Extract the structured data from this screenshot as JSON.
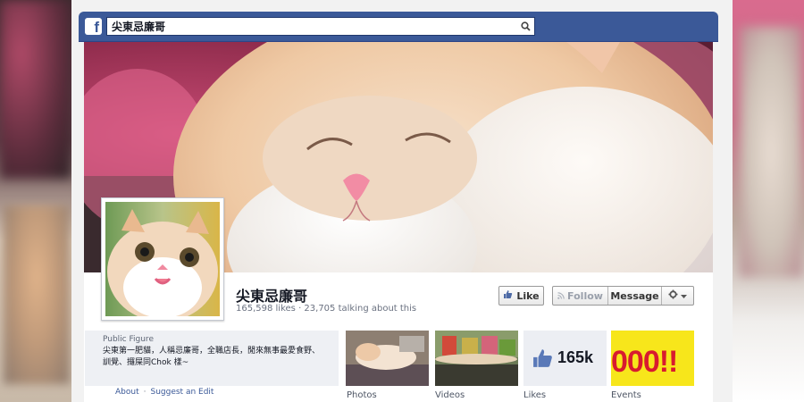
{
  "topbar": {
    "search_value": "尖東忌廉哥",
    "icons": {
      "logo": "facebook-logo",
      "search": "magnifier-icon"
    }
  },
  "page": {
    "name": "尖東忌廉哥",
    "stats": "165,598 likes · 23,705 talking about this"
  },
  "actions": {
    "like_label": "Like",
    "follow_label": "Follow",
    "message_label": "Message",
    "icons": {
      "like": "thumbs-up-icon",
      "follow": "rss-icon",
      "settings": "gear-icon",
      "dropdown": "caret-down-icon"
    }
  },
  "about": {
    "category": "Public Figure",
    "description": "尖東第一肥貓，人稱忌廉哥，全職店長，閒來無事最愛食野、訓覺、攞屎同Chok 樣~",
    "link_about": "About",
    "separator": "·",
    "link_suggest": "Suggest an Edit"
  },
  "apps": [
    {
      "label": "Photos"
    },
    {
      "label": "Videos"
    },
    {
      "label": "Likes",
      "count": "165k"
    },
    {
      "label": "Events",
      "image_text": "000!!"
    }
  ],
  "colors": {
    "facebook_blue": "#3b5998",
    "link": "#3b5998"
  }
}
